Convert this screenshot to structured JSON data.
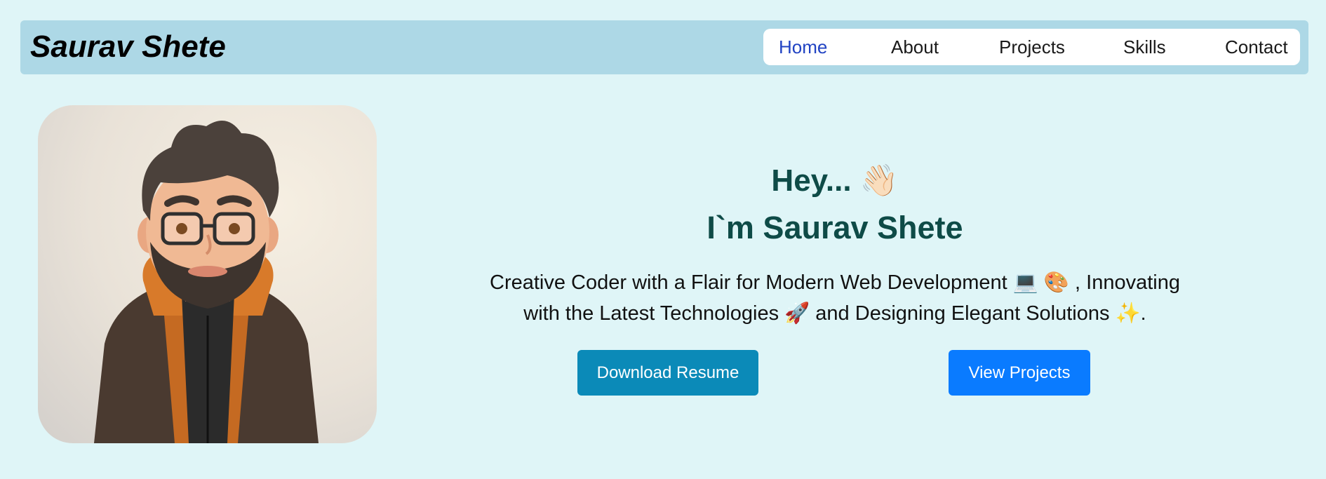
{
  "nav": {
    "brand": "Saurav Shete",
    "links": [
      {
        "label": "Home",
        "active": true
      },
      {
        "label": "About",
        "active": false
      },
      {
        "label": "Projects",
        "active": false
      },
      {
        "label": "Skills",
        "active": false
      },
      {
        "label": "Contact",
        "active": false
      }
    ]
  },
  "hero": {
    "greeting": "Hey... 👋🏻",
    "name": "I`m Saurav Shete",
    "tagline_line1": "Creative Coder with a Flair for Modern Web Development 💻 🎨 , Innovating",
    "tagline_line2": "with the Latest Technologies 🚀 and Designing Elegant Solutions ✨."
  },
  "buttons": {
    "resume": "Download Resume",
    "projects": "View Projects"
  },
  "colors": {
    "page_bg": "#dff5f7",
    "navbar_bg": "#add8e6",
    "active_link": "#2143c3",
    "heading": "#0e4b47",
    "resume_button": "#0b8ab8",
    "projects_button": "#0a7bff"
  }
}
